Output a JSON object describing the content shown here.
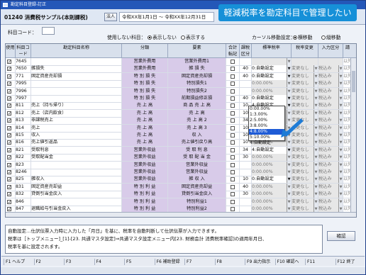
{
  "window": {
    "title": "勘定科目登録-訂正"
  },
  "header": {
    "company": "01240 消費税サンプル(本則課税)",
    "corp_btn": "法人",
    "period": "令和XX年1月1日 ～ 令和XX年12月31日",
    "banner": "軽減税率を勘定科目で管理したい"
  },
  "toolbar": {
    "code_label": "科目コード：",
    "code_value": "",
    "unused_label": "使用しない科目：",
    "radio_hide": "表示しない",
    "radio_show": "表示する",
    "cursor_label": "カーソル移動設定：",
    "radio_h": "横移動",
    "radio_v": "縦移動"
  },
  "columns": [
    "使用",
    "科目コード",
    "勘定科目名称",
    "分類",
    "要素",
    "合計転記",
    "課税区分",
    "標準税率",
    "税率変更",
    "入力区分",
    "請"
  ],
  "rows": [
    {
      "code": "7645",
      "name": "",
      "class": "営業外費用",
      "elem": "営業外費用1",
      "kazei": "",
      "rate": "",
      "ratechg": "",
      "input": ""
    },
    {
      "code": "7650",
      "name": "雑損失",
      "class": "営業外費用",
      "elem": "雑 損 失",
      "kazei": "40",
      "rate": "0:自動設定",
      "ratechg": "変更なし",
      "input": "税込み"
    },
    {
      "code": "771",
      "name": "固定資産売却損",
      "class": "特 別 損 失",
      "elem": "固定資産売却損",
      "kazei": "40",
      "rate": "0:自動設定",
      "ratechg": "変更なし",
      "input": "税込み"
    },
    {
      "code": "7995",
      "name": "",
      "class": "特 別 損 失",
      "elem": "特別損失1",
      "kazei": "",
      "rate": "0:00.00%",
      "ratechg": "変更なし",
      "input": "税込み"
    },
    {
      "code": "7996",
      "name": "",
      "class": "特 別 損 失",
      "elem": "特別損失2",
      "kazei": "",
      "rate": "0:00.00%",
      "ratechg": "変更なし",
      "input": "税込み"
    },
    {
      "code": "7997",
      "name": "",
      "class": "特 別 損 失",
      "elem": "前期損益修正損",
      "kazei": "40",
      "rate": "0:自動設定",
      "ratechg": "変更なし",
      "input": "税込み"
    },
    {
      "code": "811",
      "name": "売上（持ち帰り）",
      "class": "売 上 高",
      "elem": "商 品 売 上 高",
      "kazei": "10",
      "rate": "4:自動設定",
      "ratechg": "変更なし",
      "input": "税込み"
    },
    {
      "code": "812",
      "name": "売上（店内飲食）",
      "class": "売 上 高",
      "elem": "売 上 高",
      "kazei": "10",
      "rate": "0:00.00%",
      "ratechg": "変更なし",
      "input": "税込み"
    },
    {
      "code": "813",
      "name": "非課税売上",
      "class": "売 上 高",
      "elem": "売 上 高 2",
      "kazei": "34",
      "rate": "1:3.00%",
      "ratechg": "変更なし",
      "input": "税込み"
    },
    {
      "code": "814",
      "name": "売上",
      "class": "売 上 高",
      "elem": "売 上 高 3",
      "kazei": "10",
      "rate": "2:5.00%",
      "ratechg": "変更なし",
      "input": "税込み"
    },
    {
      "code": "815",
      "name": "収入",
      "class": "売 上 高",
      "elem": "収 入",
      "kazei": "10",
      "rate": "3:8.00%",
      "ratechg": "変更なし",
      "input": "税込み"
    },
    {
      "code": "816",
      "name": "売上値引返品",
      "class": "売 上 高",
      "elem": "売上値引戻り高",
      "kazei": "10",
      "rate": "5:10.00%",
      "ratechg": "変更なし",
      "input": "税込み"
    },
    {
      "code": "821",
      "name": "受取利息",
      "class": "営業外収益",
      "elem": "受 取 利 息",
      "kazei": "34",
      "rate": "4:自動設定",
      "ratechg": "変更なし",
      "input": "税込み"
    },
    {
      "code": "822",
      "name": "受取配当金",
      "class": "営業外収益",
      "elem": "受 取 配 当 金",
      "kazei": "30",
      "rate": "0:00.00%",
      "ratechg": "変更なし",
      "input": "税込み"
    },
    {
      "code": "823",
      "name": "",
      "class": "営業外収益",
      "elem": "営業外収益",
      "kazei": "",
      "rate": "0:00.00%",
      "ratechg": "変更なし",
      "input": "税込み"
    },
    {
      "code": "8246",
      "name": "",
      "class": "営業外収益",
      "elem": "営業外収益",
      "kazei": "",
      "rate": "0:00.00%",
      "ratechg": "変更なし",
      "input": "税込み"
    },
    {
      "code": "825",
      "name": "雑収入",
      "class": "営業外収益",
      "elem": "雑 収 入",
      "kazei": "10",
      "rate": "0:自動設定",
      "ratechg": "変更なし",
      "input": "税込み"
    },
    {
      "code": "831",
      "name": "固定資産売却益",
      "class": "特 別 利 益",
      "elem": "固定資産売却益",
      "kazei": "40",
      "rate": "0:00.00%",
      "ratechg": "変更なし",
      "input": "税込み"
    },
    {
      "code": "832",
      "name": "貸倒引当金戻入",
      "class": "特 別 利 益",
      "elem": "貸倒引当金戻入",
      "kazei": "30",
      "rate": "0:00.00%",
      "ratechg": "変更なし",
      "input": "税込み"
    },
    {
      "code": "846",
      "name": "",
      "class": "特 別 利 益",
      "elem": "特別利益1",
      "kazei": "",
      "rate": "0:00.00%",
      "ratechg": "変更なし",
      "input": "税込み"
    },
    {
      "code": "847",
      "name": "退職給与引当金戻入",
      "class": "特 別 利 益",
      "elem": "特別利益2",
      "kazei": "",
      "rate": "0:00.00%",
      "ratechg": "変更なし",
      "input": "税込み"
    },
    {
      "code": "848",
      "name": "",
      "class": "特 別 利 益",
      "elem": "前期損益修正益",
      "kazei": "",
      "rate": "0:00.00%",
      "ratechg": "変更なし",
      "input": "税込み"
    }
  ],
  "dropdown": {
    "options": [
      "0:00.00%",
      "1:3.00%",
      "2:5.00%",
      "3:8.00%",
      "4:8.00%",
      "5:10.00%",
      "4:自動設定"
    ],
    "selected_index": 4
  },
  "note": {
    "text": "自動設定…仕訳伝票入力時に入力した「月日」を基に、税率を自動判断して仕訳伝票が入力できます。\n税率は［トップメニュー]_[1]-[23. 共通マスタ設定]⇒共通マスタ設定メニュー内[23. 財務会計 消費税率確認]の適用年月日、\n税率を基に設定されます。"
  },
  "confirm_label": "確認",
  "fkeys": [
    "F1 ヘルプ",
    "F2",
    "F3",
    "F4",
    "F5",
    "F6 補助登録",
    "F7",
    "F8",
    "F9 出力指示",
    "F10 確認へ",
    "F11",
    "F12 終了"
  ]
}
